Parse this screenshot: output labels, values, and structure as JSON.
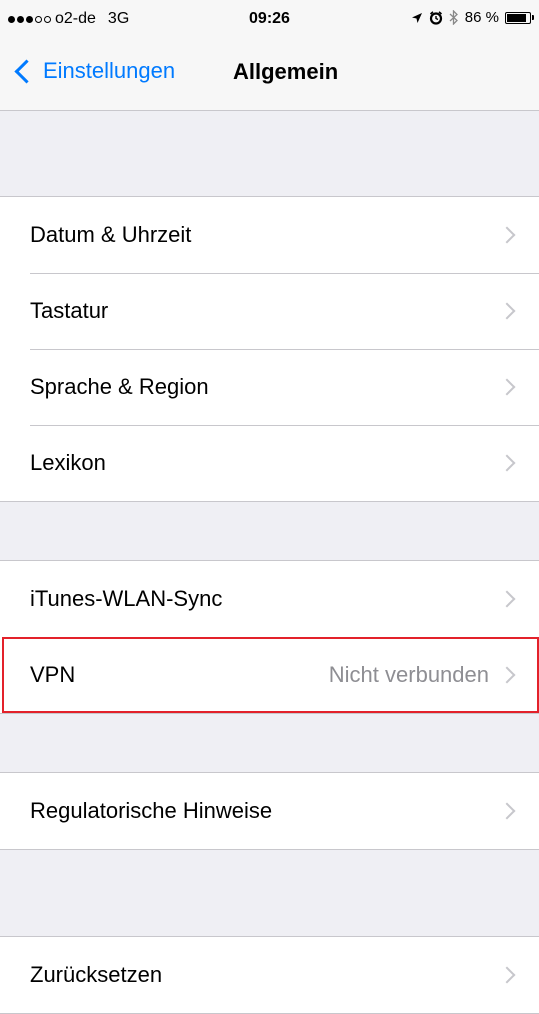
{
  "status_bar": {
    "signal": {
      "filled": 3,
      "total": 5
    },
    "carrier": "o2-de",
    "network": "3G",
    "time": "09:26",
    "battery_percent": "86 %",
    "battery_level": 0.86,
    "icons": [
      "location-arrow-icon",
      "alarm-icon",
      "bluetooth-icon",
      "battery-icon"
    ]
  },
  "nav": {
    "back_label": "Einstellungen",
    "title": "Allgemein"
  },
  "groups": [
    {
      "rows": [
        {
          "label": "Datum & Uhrzeit",
          "name": "datum-uhrzeit"
        },
        {
          "label": "Tastatur",
          "name": "tastatur"
        },
        {
          "label": "Sprache & Region",
          "name": "sprache-region"
        },
        {
          "label": "Lexikon",
          "name": "lexikon"
        }
      ]
    },
    {
      "rows": [
        {
          "label": "iTunes-WLAN-Sync",
          "name": "itunes-wlan-sync"
        },
        {
          "label": "VPN",
          "name": "vpn",
          "value": "Nicht verbunden",
          "highlighted": true
        }
      ]
    },
    {
      "rows": [
        {
          "label": "Regulatorische Hinweise",
          "name": "regulatorische-hinweise"
        }
      ]
    },
    {
      "rows": [
        {
          "label": "Zurücksetzen",
          "name": "zuruecksetzen"
        }
      ]
    }
  ],
  "colors": {
    "accent": "#007aff",
    "highlight": "#e3212a",
    "secondary_text": "#8e8e93",
    "background": "#efeff4"
  }
}
